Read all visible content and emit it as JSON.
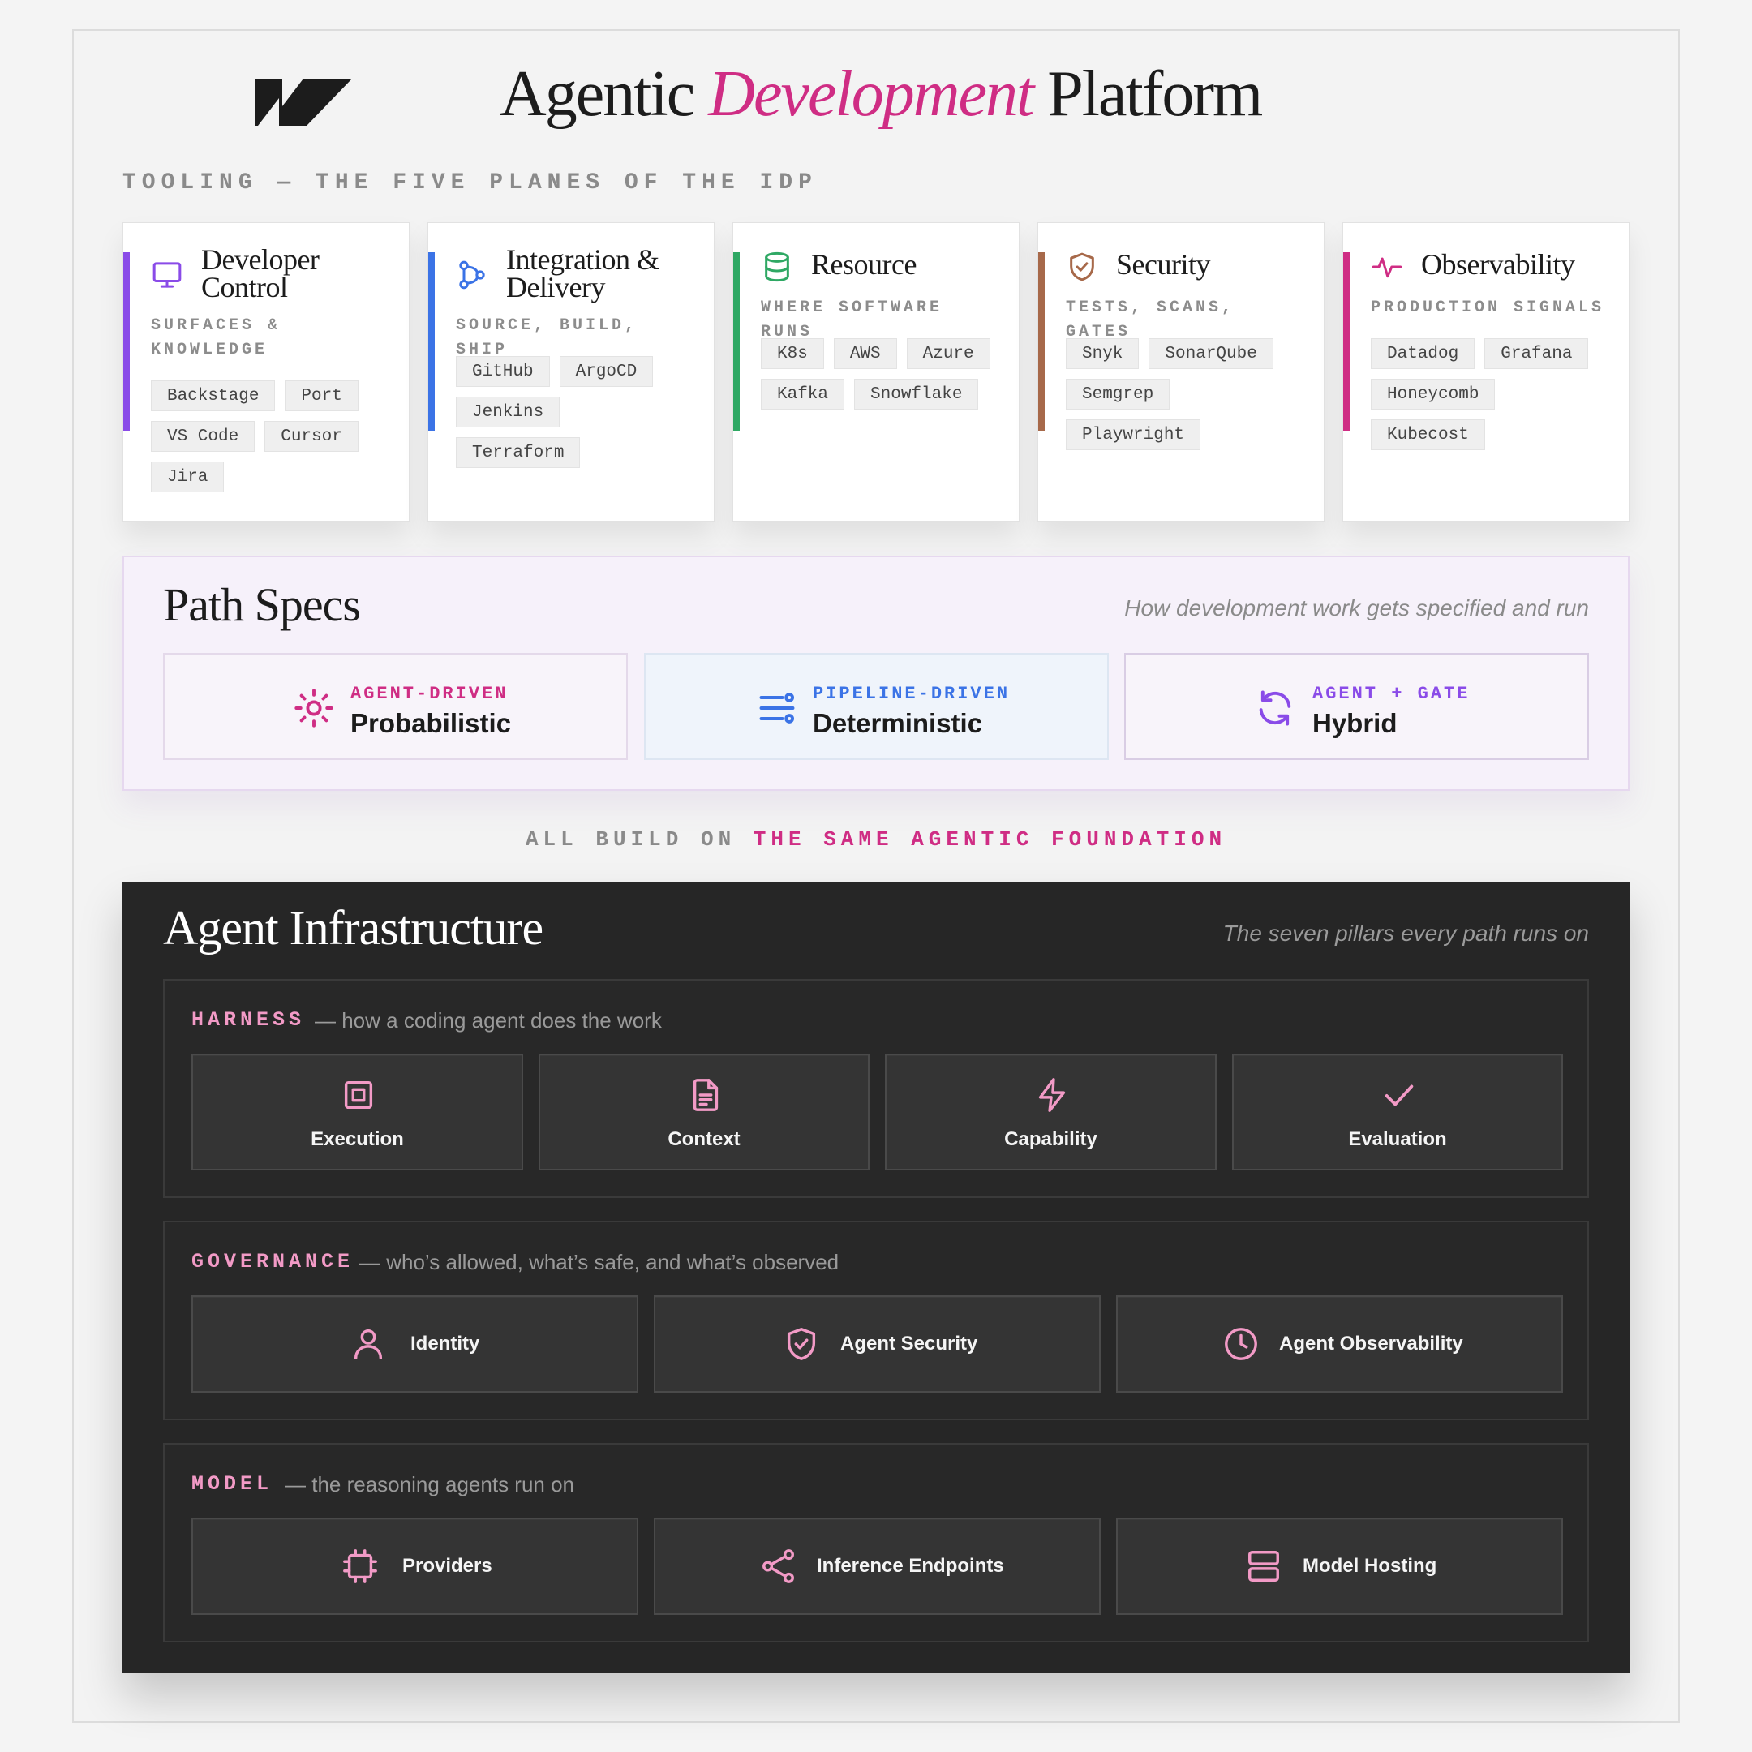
{
  "header": {
    "title_start": "Agentic",
    "title_accent": "Development",
    "title_end": "Platform"
  },
  "tooling": {
    "heading": "TOOLING — THE FIVE PLANES OF THE IDP",
    "planes": [
      {
        "title": "Developer Control",
        "subtitle": "SURFACES & KNOWLEDGE",
        "tags": [
          "Backstage",
          "Port",
          "VS Code",
          "Cursor",
          "Jira"
        ],
        "color": "#8a4be8",
        "icon": "monitor-icon"
      },
      {
        "title": "Integration & Delivery",
        "subtitle": "SOURCE, BUILD, SHIP",
        "tags": [
          "GitHub",
          "ArgoCD",
          "Jenkins",
          "Terraform"
        ],
        "color": "#3b73e6",
        "icon": "git-branch-icon"
      },
      {
        "title": "Resource",
        "subtitle": "WHERE SOFTWARE RUNS",
        "tags": [
          "K8s",
          "AWS",
          "Azure",
          "Kafka",
          "Snowflake"
        ],
        "color": "#2fa864",
        "icon": "database-icon"
      },
      {
        "title": "Security",
        "subtitle": "TESTS, SCANS, GATES",
        "tags": [
          "Snyk",
          "SonarQube",
          "Semgrep",
          "Playwright"
        ],
        "color": "#a7694a",
        "icon": "shield-check-icon"
      },
      {
        "title": "Observability",
        "subtitle": "PRODUCTION SIGNALS",
        "tags": [
          "Datadog",
          "Grafana",
          "Honeycomb",
          "Kubecost"
        ],
        "color": "#cf2d84",
        "icon": "activity-icon"
      }
    ]
  },
  "path_specs": {
    "title": "Path Specs",
    "subtitle": "How development work gets specified and run",
    "specs": [
      {
        "kicker": "AGENT-DRIVEN",
        "name": "Probabilistic",
        "color": "#cf2d84",
        "icon": "sun-icon"
      },
      {
        "kicker": "PIPELINE-DRIVEN",
        "name": "Deterministic",
        "color": "#3b73e6",
        "icon": "sliders-icon"
      },
      {
        "kicker": "AGENT + GATE",
        "name": "Hybrid",
        "color": "#8a4be8",
        "icon": "refresh-icon"
      }
    ]
  },
  "foundation": {
    "prefix": "ALL BUILD ON ",
    "highlight": "THE SAME AGENTIC FOUNDATION"
  },
  "infra": {
    "title": "Agent Infrastructure",
    "subtitle": "The seven pillars every path runs on",
    "accent": "#f29ac6",
    "groups": [
      {
        "label": "HARNESS",
        "desc": "— how a coding agent does the work",
        "pillars": [
          {
            "name": "Execution",
            "icon": "cpu-square-icon"
          },
          {
            "name": "Context",
            "icon": "file-text-icon"
          },
          {
            "name": "Capability",
            "icon": "zap-icon"
          },
          {
            "name": "Evaluation",
            "icon": "check-icon"
          }
        ]
      },
      {
        "label": "GOVERNANCE",
        "desc": "— who’s allowed, what’s safe, and what’s observed",
        "pillars": [
          {
            "name": "Identity",
            "icon": "user-icon"
          },
          {
            "name": "Agent Security",
            "icon": "shield-check-icon"
          },
          {
            "name": "Agent Observability",
            "icon": "clock-icon"
          }
        ]
      },
      {
        "label": "MODEL",
        "desc": "— the reasoning agents run on",
        "pillars": [
          {
            "name": "Providers",
            "icon": "chip-icon"
          },
          {
            "name": "Inference Endpoints",
            "icon": "share-icon"
          },
          {
            "name": "Model Hosting",
            "icon": "server-icon"
          }
        ]
      }
    ]
  }
}
